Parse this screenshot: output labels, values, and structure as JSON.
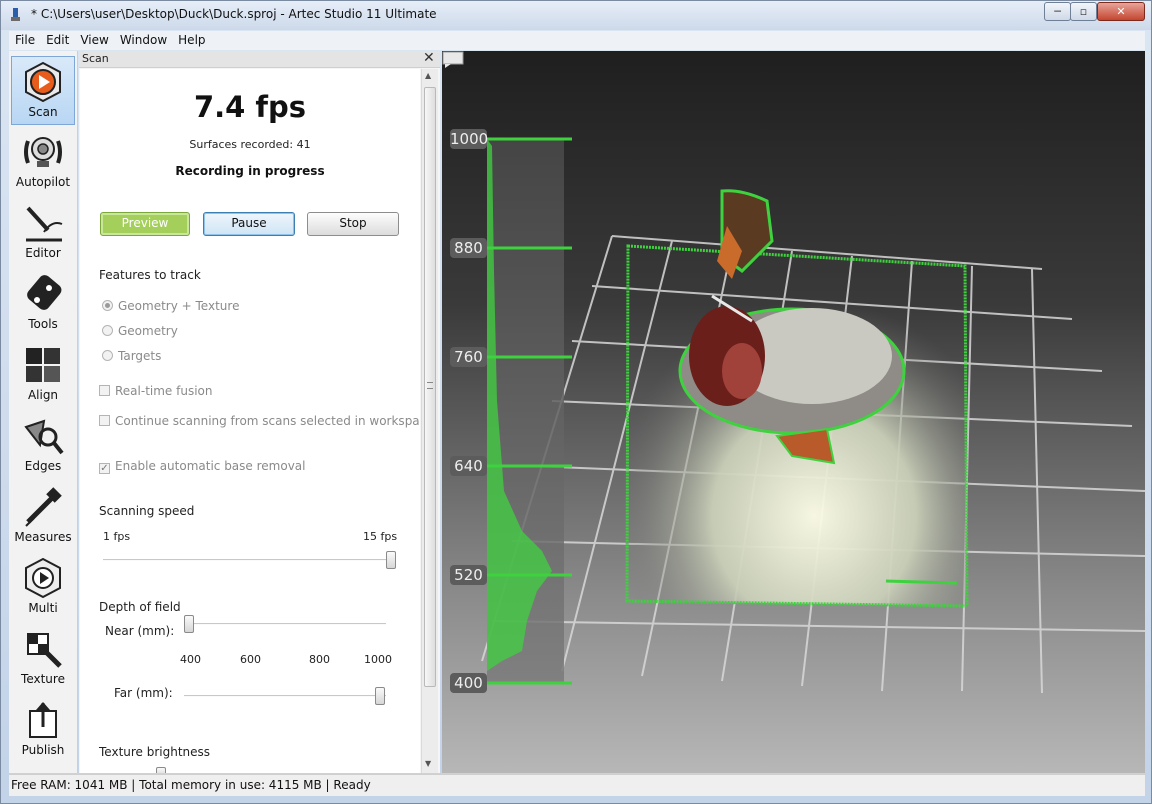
{
  "window": {
    "title": "* C:\\Users\\user\\Desktop\\Duck\\Duck.sproj - Artec Studio 11 Ultimate",
    "min_label": "─",
    "max_label": "▫",
    "close_label": "✕"
  },
  "menu": [
    "File",
    "Edit",
    "View",
    "Window",
    "Help"
  ],
  "tools": [
    {
      "label": "Scan",
      "icon": "scan-icon"
    },
    {
      "label": "Autopilot",
      "icon": "autopilot-icon"
    },
    {
      "label": "Editor",
      "icon": "editor-icon"
    },
    {
      "label": "Tools",
      "icon": "tools-icon"
    },
    {
      "label": "Align",
      "icon": "align-icon"
    },
    {
      "label": "Edges",
      "icon": "edges-icon"
    },
    {
      "label": "Measures",
      "icon": "measures-icon"
    },
    {
      "label": "Multi",
      "icon": "multi-icon"
    },
    {
      "label": "Texture",
      "icon": "texture-icon"
    },
    {
      "label": "Publish",
      "icon": "publish-icon"
    }
  ],
  "panel": {
    "title": "Scan",
    "close": "✕",
    "fps": "7.4 fps",
    "surfaces": "Surfaces recorded: 41",
    "status": "Recording in progress",
    "buttons": {
      "preview": "Preview",
      "pause": "Pause",
      "stop": "Stop"
    },
    "features_label": "Features to track",
    "features": [
      {
        "label": "Geometry + Texture",
        "selected": true
      },
      {
        "label": "Geometry",
        "selected": false
      },
      {
        "label": "Targets",
        "selected": false
      }
    ],
    "realtime_fusion": "Real-time fusion",
    "continue_scanning": "Continue scanning from scans selected in workspace",
    "auto_base_removal": "Enable automatic base removal",
    "auto_base_removal_checked": true,
    "scanning_speed": {
      "label": "Scanning speed",
      "min_label": "1 fps",
      "max_label": "15 fps",
      "value": 15
    },
    "depth_of_field": {
      "label": "Depth of field",
      "near_label": "Near (mm):",
      "far_label": "Far (mm):",
      "ticks": [
        "400",
        "600",
        "800",
        "1000"
      ],
      "near_value": 400,
      "far_value": 1000
    },
    "texture_brightness": "Texture brightness"
  },
  "status": "Free RAM: 1041 MB  |  Total memory in use: 4115 MB  |   Ready",
  "viewport": {
    "depth_scale": [
      "1000",
      "880",
      "760",
      "640",
      "520",
      "400"
    ],
    "colors": {
      "accent_green": "#3fd23f",
      "grid": "#d8d8d8"
    }
  }
}
